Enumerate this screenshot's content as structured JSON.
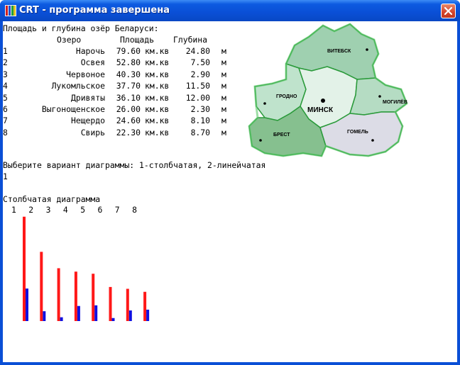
{
  "window": {
    "title": "CRT - программа завершена",
    "icon": "crt-app-icon",
    "close_icon": "close-icon"
  },
  "console": {
    "heading": "Площадь и глубина озёр Беларуси:",
    "columns": {
      "lake": "Озеро",
      "area": "Площадь",
      "depth": "Глубина"
    },
    "rows": [
      {
        "n": "1",
        "name": "Нарочь",
        "area": "79.60",
        "area_unit": "км.кв",
        "depth": "24.80",
        "depth_unit": "м"
      },
      {
        "n": "2",
        "name": "Освея",
        "area": "52.80",
        "area_unit": "км.кв",
        "depth": "7.50",
        "depth_unit": "м"
      },
      {
        "n": "3",
        "name": "Червоное",
        "area": "40.30",
        "area_unit": "км.кв",
        "depth": "2.90",
        "depth_unit": "м"
      },
      {
        "n": "4",
        "name": "Лукомльское",
        "area": "37.70",
        "area_unit": "км.кв",
        "depth": "11.50",
        "depth_unit": "м"
      },
      {
        "n": "5",
        "name": "Дривяты",
        "area": "36.10",
        "area_unit": "км.кв",
        "depth": "12.00",
        "depth_unit": "м"
      },
      {
        "n": "6",
        "name": "Выгонощенское",
        "area": "26.00",
        "area_unit": "км.кв",
        "depth": "2.30",
        "depth_unit": "м"
      },
      {
        "n": "7",
        "name": "Нещердо",
        "area": "24.60",
        "area_unit": "км.кв",
        "depth": "8.10",
        "depth_unit": "м"
      },
      {
        "n": "8",
        "name": "Свирь",
        "area": "22.30",
        "area_unit": "км.кв",
        "depth": "8.70",
        "depth_unit": "м"
      }
    ],
    "prompt": "Выберите вариант диаграммы: 1-столбчатая, 2-линейчатая",
    "input_value": "1",
    "chart_heading": "Столбчатая диаграмма"
  },
  "map": {
    "regions": [
      "ВИТЕБСК",
      "ГРОДНО",
      "МИНСК",
      "МОГИЛЁВ",
      "БРЕСТ",
      "ГОМЕЛЬ"
    ],
    "colors": {
      "vitebsk": "#9fd0b0",
      "grodno": "#bfe3cc",
      "minsk": "#e3f2e8",
      "mogilev": "#b5dcc3",
      "brest": "#86c08f",
      "gomel": "#dcdce6",
      "border": "#2a9a3a"
    }
  },
  "chart_data": {
    "type": "bar",
    "categories": [
      "1",
      "2",
      "3",
      "4",
      "5",
      "6",
      "7",
      "8"
    ],
    "series": [
      {
        "values": [
          79.6,
          52.8,
          40.3,
          37.7,
          36.1,
          26.0,
          24.6,
          22.3
        ],
        "color": "#ff1818"
      },
      {
        "values": [
          24.8,
          7.5,
          2.9,
          11.5,
          12.0,
          2.3,
          8.1,
          8.7
        ],
        "color": "#1010e0"
      }
    ],
    "xlabel": "",
    "ylabel": ""
  }
}
